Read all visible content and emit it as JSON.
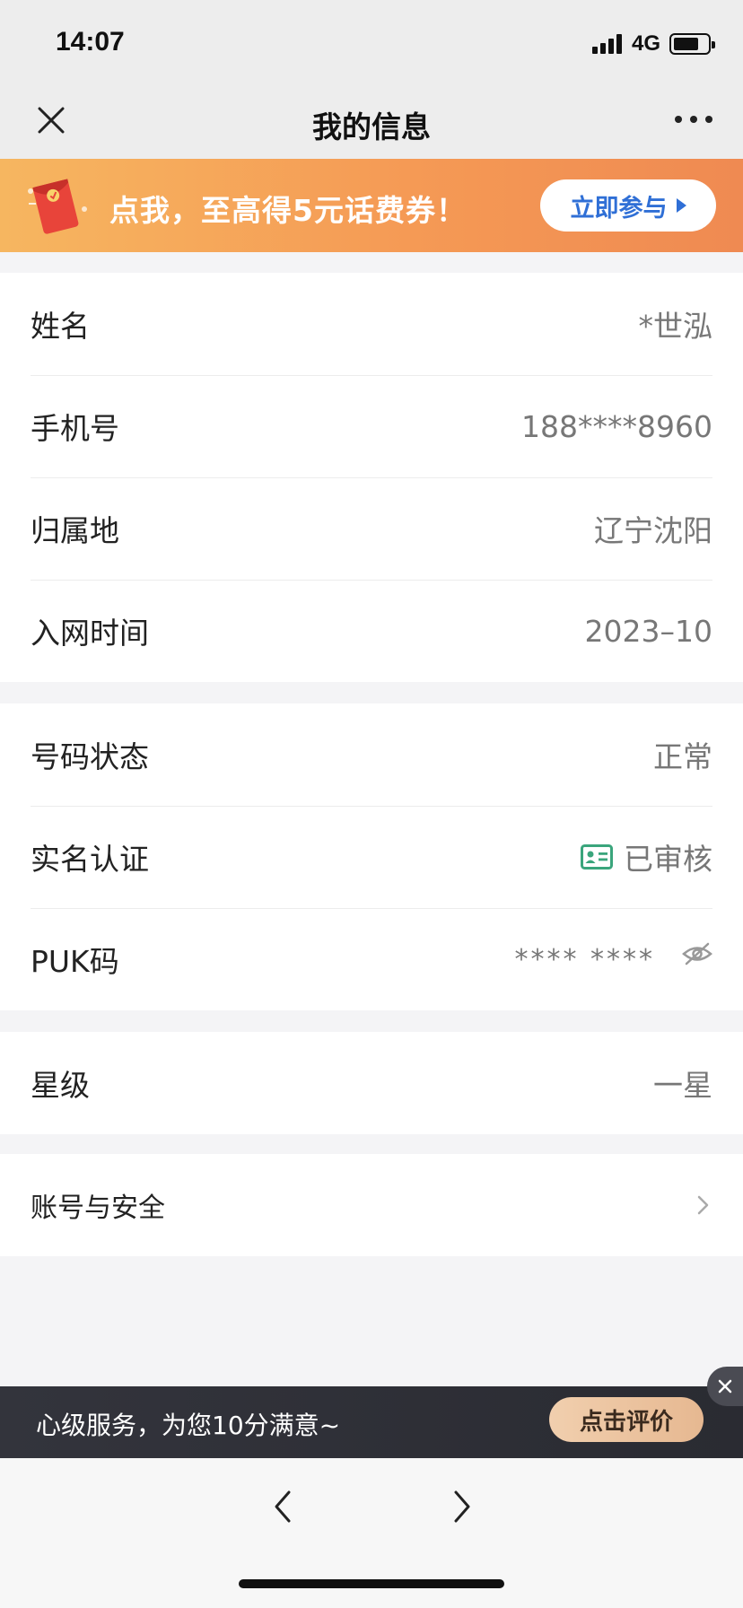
{
  "status_bar": {
    "time": "14:07",
    "network": "4G"
  },
  "nav": {
    "title": "我的信息"
  },
  "promo": {
    "text": "点我，至高得5元话费券！",
    "button_label": "立即参与"
  },
  "group1": [
    {
      "label": "姓名",
      "value": "*世泓"
    },
    {
      "label": "手机号",
      "value": "188****8960"
    },
    {
      "label": "归属地",
      "value": "辽宁沈阳"
    },
    {
      "label": "入网时间",
      "value": "2023–10"
    }
  ],
  "group2": {
    "status_label": "号码状态",
    "status_value": "正常",
    "realname_label": "实名认证",
    "realname_value": "已审核",
    "puk_label": "PUK码",
    "puk_value": "**** ****"
  },
  "group3": {
    "star_label": "星级",
    "star_value": "一星"
  },
  "group4": {
    "account_label": "账号与安全"
  },
  "service": {
    "text": "心级服务，为您10分满意~",
    "button_label": "点击评价"
  },
  "icons": {
    "close": "close-icon",
    "more": "more-icon",
    "promo": "red-envelope-icon",
    "id_card": "id-card-icon",
    "eye": "eye-hidden-icon",
    "chevron": "chevron-right-icon",
    "back": "back-arrow-icon",
    "forward": "forward-arrow-icon"
  },
  "colors": {
    "accent_blue": "#2f6fd6",
    "banner_orange": "#f59a55",
    "id_green": "#3aa57c"
  }
}
